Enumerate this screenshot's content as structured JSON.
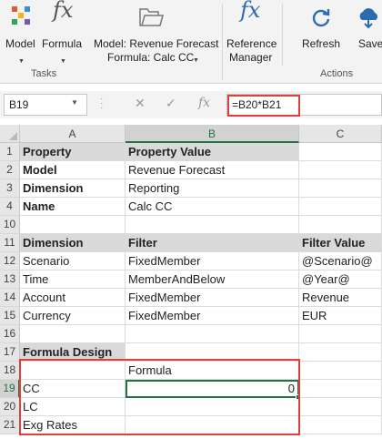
{
  "ribbon": {
    "model_label": "Model",
    "formula_label": "Formula",
    "context_line1": "Model: Revenue Forecast",
    "context_line2": "Formula: Calc CC",
    "ref_mgr_line1": "Reference",
    "ref_mgr_line2": "Manager",
    "refresh_label": "Refresh",
    "save_label": "Save",
    "tasks_group": "Tasks",
    "actions_group": "Actions",
    "fx_glyph": "fx"
  },
  "formula_bar": {
    "name_box": "B19",
    "cancel_glyph": "✕",
    "enter_glyph": "✓",
    "fx_glyph": "fx",
    "formula": "=B20*B21"
  },
  "sheet": {
    "columns": [
      "A",
      "B",
      "C"
    ],
    "selected_column": "B",
    "selected_row": "19",
    "rows": [
      {
        "n": "1",
        "a": "Property",
        "b": "Property Value",
        "c": ""
      },
      {
        "n": "2",
        "a": "Model",
        "b": "Revenue Forecast",
        "c": ""
      },
      {
        "n": "3",
        "a": "Dimension",
        "b": "Reporting",
        "c": ""
      },
      {
        "n": "4",
        "a": "Name",
        "b": "Calc CC",
        "c": ""
      },
      {
        "n": "10",
        "a": "",
        "b": "",
        "c": ""
      },
      {
        "n": "11",
        "a": "Dimension",
        "b": "Filter",
        "c": "Filter Value"
      },
      {
        "n": "12",
        "a": "Scenario",
        "b": "FixedMember",
        "c": "@Scenario@"
      },
      {
        "n": "13",
        "a": "Time",
        "b": "MemberAndBelow",
        "c": "@Year@"
      },
      {
        "n": "14",
        "a": "Account",
        "b": "FixedMember",
        "c": "Revenue"
      },
      {
        "n": "15",
        "a": "Currency",
        "b": "FixedMember",
        "c": "EUR"
      },
      {
        "n": "16",
        "a": "",
        "b": "",
        "c": ""
      },
      {
        "n": "17",
        "a": "Formula Design",
        "b": "",
        "c": ""
      },
      {
        "n": "18",
        "a": "",
        "b": "Formula",
        "c": ""
      },
      {
        "n": "19",
        "a": "CC",
        "b": "0",
        "c": ""
      },
      {
        "n": "20",
        "a": "LC",
        "b": "",
        "c": ""
      },
      {
        "n": "21",
        "a": "Exg Rates",
        "b": "",
        "c": ""
      }
    ]
  },
  "colors": {
    "accent_green": "#217346",
    "highlight_red": "#e0403a",
    "header_grey": "#d9d9d9",
    "icon_blue": "#2b6cb0"
  }
}
